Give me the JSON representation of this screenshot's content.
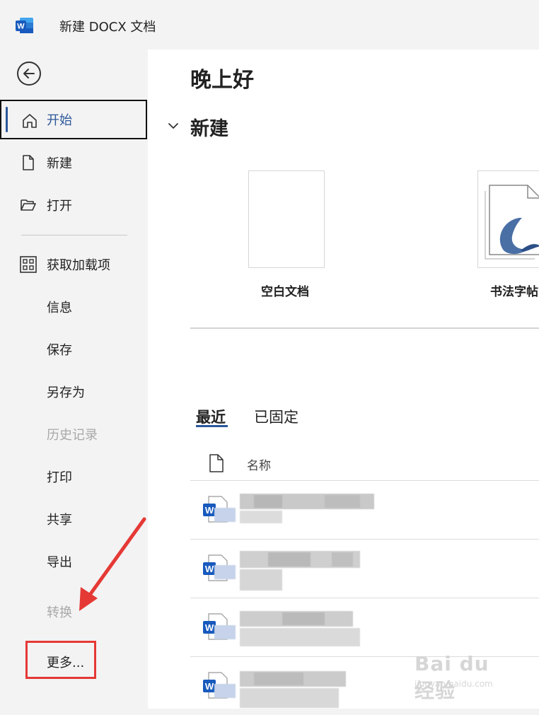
{
  "titlebar": {
    "app_logo_letter": "W",
    "document_title": "新建 DOCX 文档"
  },
  "sidebar": {
    "items": [
      {
        "label": "开始",
        "icon": "home-icon"
      },
      {
        "label": "新建",
        "icon": "new-document-icon"
      },
      {
        "label": "打开",
        "icon": "folder-open-icon"
      },
      {
        "label": "获取加载项",
        "icon": "grid-icon"
      },
      {
        "label": "信息"
      },
      {
        "label": "保存"
      },
      {
        "label": "另存为"
      },
      {
        "label": "历史记录",
        "disabled": true
      },
      {
        "label": "打印"
      },
      {
        "label": "共享"
      },
      {
        "label": "导出"
      },
      {
        "label": "转换",
        "disabled": true
      },
      {
        "label": "更多..."
      }
    ]
  },
  "main": {
    "greeting": "晚上好",
    "new_section": {
      "heading": "新建",
      "templates": [
        {
          "label": "空白文档"
        },
        {
          "label": "书法字帖"
        }
      ]
    },
    "tabs": [
      {
        "label": "最近",
        "selected": true
      },
      {
        "label": "已固定"
      }
    ],
    "file_list": {
      "column_name": "名称",
      "rows": 4
    }
  },
  "watermark": {
    "text": "Bai du 经验",
    "sub": "jingyan.baidu.com"
  },
  "colors": {
    "accent": "#2b579a",
    "highlight_box": "#e53935",
    "word_blue": "#185abd"
  }
}
